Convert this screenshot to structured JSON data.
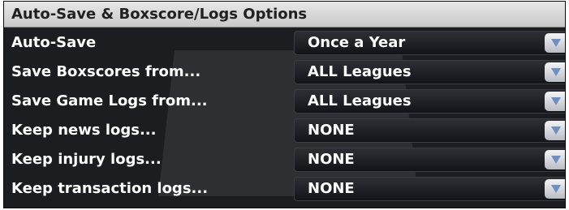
{
  "panel": {
    "title": "Auto-Save & Boxscore/Logs Options"
  },
  "rows": [
    {
      "label": "Auto-Save",
      "value": "Once a Year"
    },
    {
      "label": "Save Boxscores from...",
      "value": "ALL Leagues"
    },
    {
      "label": "Save Game Logs from...",
      "value": "ALL Leagues"
    },
    {
      "label": "Keep news logs...",
      "value": "NONE"
    },
    {
      "label": "Keep injury logs...",
      "value": "NONE"
    },
    {
      "label": "Keep transaction logs...",
      "value": "NONE"
    }
  ],
  "icons": {
    "dropdown": "chevron-down-icon"
  },
  "colors": {
    "panel_background": "#1c1d21",
    "header_background": "#d8d8d8",
    "text": "#ffffff",
    "dropdown_arrow": "#6f8fc0"
  }
}
